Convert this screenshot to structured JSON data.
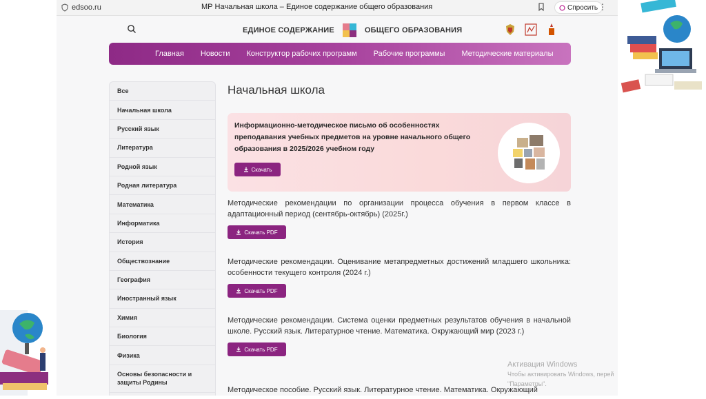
{
  "browser": {
    "url": "edsoo.ru",
    "tab_title": "МР Начальная школа – Единое содержание общего образования",
    "ask_button": "Спросить"
  },
  "header": {
    "title_left": "ЕДИНОЕ СОДЕРЖАНИЕ",
    "title_right": "ОБЩЕГО ОБРАЗОВАНИЯ"
  },
  "nav": {
    "items": [
      "Главная",
      "Новости",
      "Конструктор рабочих программ",
      "Рабочие программы",
      "Методические материалы"
    ]
  },
  "sidebar": {
    "items": [
      "Все",
      "Начальная школа",
      "Русский язык",
      "Литература",
      "Родной язык",
      "Родная литература",
      "Математика",
      "Информатика",
      "История",
      "Обществознание",
      "География",
      "Иностранный язык",
      "Химия",
      "Биология",
      "Физика",
      "Основы безопасности и защиты Родины"
    ]
  },
  "main": {
    "title": "Начальная школа",
    "banner": {
      "text": "Информационно-методическое письмо об особенностях преподавания учебных предметов на уровне начального общего образования в 2025/2026 учебном году",
      "button": "Скачать"
    },
    "documents": [
      {
        "text": "Методические рекомендации по организации процесса обучения в первом классе в адаптационный период (сентябрь-октябрь) (2025г.)",
        "button": "Скачать PDF"
      },
      {
        "text": "Методические рекомендации. Оценивание метапредметных достижений младшего школьника: особенности текущего контроля (2024 г.)",
        "button": "Скачать PDF"
      },
      {
        "text": "Методические рекомендации. Система оценки предметных результатов обучения в начальной школе. Русский язык. Литературное чтение. Математика. Окружающий мир (2023 г.)",
        "button": "Скачать PDF"
      },
      {
        "text": "Методическое пособие. Русский язык. Литературное чтение. Математика. Окружающий",
        "button": ""
      }
    ]
  },
  "watermark": {
    "title": "Активация Windows",
    "line1": "Чтобы активировать Windows, перей",
    "line2": "\"Параметры\"."
  },
  "colors": {
    "accent": "#8b2480",
    "nav_gradient_start": "#8e2a86",
    "nav_gradient_end": "#c873be",
    "banner_bg": "#fbe1e4",
    "page_bg": "#f7f7f8"
  }
}
